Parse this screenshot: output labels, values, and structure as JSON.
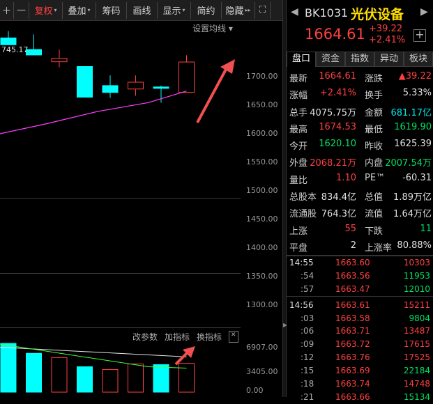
{
  "toolbar": {
    "items": [
      {
        "label": "＋"
      },
      {
        "label": "—"
      },
      {
        "label": "复权",
        "caret": "▾"
      },
      {
        "label": "叠加",
        "caret": "▾"
      },
      {
        "label": "筹码"
      },
      {
        "label": "画线"
      },
      {
        "label": "显示",
        "caret": "▾"
      },
      {
        "label": "简约"
      },
      {
        "label": "隐藏",
        "caret": "▸▸"
      },
      {
        "label": "⛶"
      }
    ],
    "setting_ma": "设置均线 ▾"
  },
  "kline": {
    "high_label": "745.17",
    "y_axis": [
      "1700.00",
      "1650.00",
      "1600.00",
      "1550.00",
      "1500.00",
      "1450.00",
      "1400.00",
      "1350.00",
      "1300.00"
    ],
    "vol_axis": [
      "6907.00",
      "3405.00",
      "0.00"
    ],
    "vol_buttons": [
      "改参数",
      "加指标",
      "换指标"
    ],
    "close_btn": "✕"
  },
  "header": {
    "nav_left": "◀",
    "nav_right": "▶",
    "code": "BK1031",
    "name": "光伏设备",
    "price": "1664.61",
    "change": "+39.22",
    "change_pct": "+2.41%",
    "plus": "+"
  },
  "tabs": [
    "盘口",
    "资金",
    "指数",
    "异动",
    "板块"
  ],
  "quote": [
    {
      "l1": "最新",
      "v1": "1664.61",
      "c1": "red",
      "l2": "涨跌",
      "v2": "▲39.22",
      "c2": "red"
    },
    {
      "l1": "涨幅",
      "v1": "+2.41%",
      "c1": "red",
      "l2": "换手",
      "v2": "5.33%",
      "c2": "white"
    },
    {
      "l1": "总手",
      "v1": "4075.75万",
      "c1": "white",
      "l2": "金额",
      "v2": "681.17亿",
      "c2": "cyan"
    },
    {
      "l1": "最高",
      "v1": "1674.53",
      "c1": "red",
      "l2": "最低",
      "v2": "1619.90",
      "c2": "green"
    },
    {
      "l1": "今开",
      "v1": "1620.10",
      "c1": "green",
      "l2": "昨收",
      "v2": "1625.39",
      "c2": "white"
    },
    {
      "l1": "外盘",
      "v1": "2068.21万",
      "c1": "red",
      "l2": "内盘",
      "v2": "2007.54万",
      "c2": "green"
    },
    {
      "l1": "量比",
      "v1": "1.10",
      "c1": "red",
      "l2": "PE™",
      "v2": "-60.31",
      "c2": "white"
    },
    {
      "l1": "总股本",
      "v1": "834.4亿",
      "c1": "white",
      "l2": "总值",
      "v2": "1.89万亿",
      "c2": "white"
    },
    {
      "l1": "流通股",
      "v1": "764.3亿",
      "c1": "white",
      "l2": "流值",
      "v2": "1.64万亿",
      "c2": "white"
    },
    {
      "l1": "上涨",
      "v1": "55",
      "c1": "red",
      "l2": "下跌",
      "v2": "11",
      "c2": "green"
    },
    {
      "l1": "平盘",
      "v1": "2",
      "c1": "white",
      "l2": "上涨率",
      "v2": "80.88%",
      "c2": "white"
    }
  ],
  "ticks_a": [
    {
      "t": "14:55",
      "sub": false,
      "p": "1663.60",
      "v": "10303",
      "c": "red"
    },
    {
      "t": ":54",
      "sub": true,
      "p": "1663.56",
      "v": "11953",
      "c": "green"
    },
    {
      "t": ":57",
      "sub": true,
      "p": "1663.47",
      "v": "12010",
      "c": "green"
    }
  ],
  "ticks_b": [
    {
      "t": "14:56",
      "sub": false,
      "p": "1663.61",
      "v": "15211",
      "c": "red"
    },
    {
      "t": ":03",
      "sub": true,
      "p": "1663.58",
      "v": "9804",
      "c": "green"
    },
    {
      "t": ":06",
      "sub": true,
      "p": "1663.71",
      "v": "13487",
      "c": "red"
    },
    {
      "t": ":09",
      "sub": true,
      "p": "1663.72",
      "v": "17615",
      "c": "red"
    },
    {
      "t": ":12",
      "sub": true,
      "p": "1663.76",
      "v": "17525",
      "c": "red"
    },
    {
      "t": ":15",
      "sub": true,
      "p": "1663.69",
      "v": "22184",
      "c": "green"
    },
    {
      "t": ":18",
      "sub": true,
      "p": "1663.74",
      "v": "14748",
      "c": "red"
    },
    {
      "t": ":21",
      "sub": true,
      "p": "1663.66",
      "v": "15134",
      "c": "green"
    }
  ],
  "chart_data": {
    "type": "candlestick",
    "ylim": [
      1275,
      1725
    ],
    "candles": [
      {
        "open": 1700,
        "close": 1690,
        "high": 1710,
        "low": 1690,
        "up": false
      },
      {
        "open": 1675,
        "close": 1683,
        "high": 1705,
        "low": 1675,
        "up": false
      },
      {
        "open": 1665,
        "close": 1670,
        "high": 1683,
        "low": 1657,
        "up": true
      },
      {
        "open": 1658,
        "close": 1613,
        "high": 1658,
        "low": 1613,
        "up": false
      },
      {
        "open": 1630,
        "close": 1620,
        "high": 1645,
        "low": 1612,
        "up": false
      },
      {
        "open": 1625,
        "close": 1635,
        "high": 1645,
        "low": 1615,
        "up": true
      },
      {
        "open": 1628,
        "close": 1626,
        "high": 1630,
        "low": 1605,
        "up": false
      },
      {
        "open": 1620,
        "close": 1664.61,
        "high": 1674.53,
        "low": 1619.9,
        "up": true
      }
    ],
    "ma": [
      [
        -0.5,
        1558
      ],
      [
        1.5,
        1574
      ],
      [
        3.5,
        1592
      ],
      [
        5.5,
        1605
      ],
      [
        7,
        1622
      ]
    ],
    "volume": {
      "ylim": [
        0,
        6907
      ],
      "bars": [
        {
          "v": 6907,
          "up": false
        },
        {
          "v": 5500,
          "up": false
        },
        {
          "v": 4900,
          "up": true
        },
        {
          "v": 3600,
          "up": false
        },
        {
          "v": 3200,
          "up": true
        },
        {
          "v": 4000,
          "up": true
        },
        {
          "v": 3900,
          "up": false
        },
        {
          "v": 4075,
          "up": true
        }
      ],
      "ma_white": [
        [
          -0.5,
          6400
        ],
        [
          7,
          5000
        ]
      ],
      "ma_green": [
        [
          -0.5,
          6900
        ],
        [
          5.5,
          3600
        ],
        [
          7,
          3405
        ]
      ]
    }
  }
}
